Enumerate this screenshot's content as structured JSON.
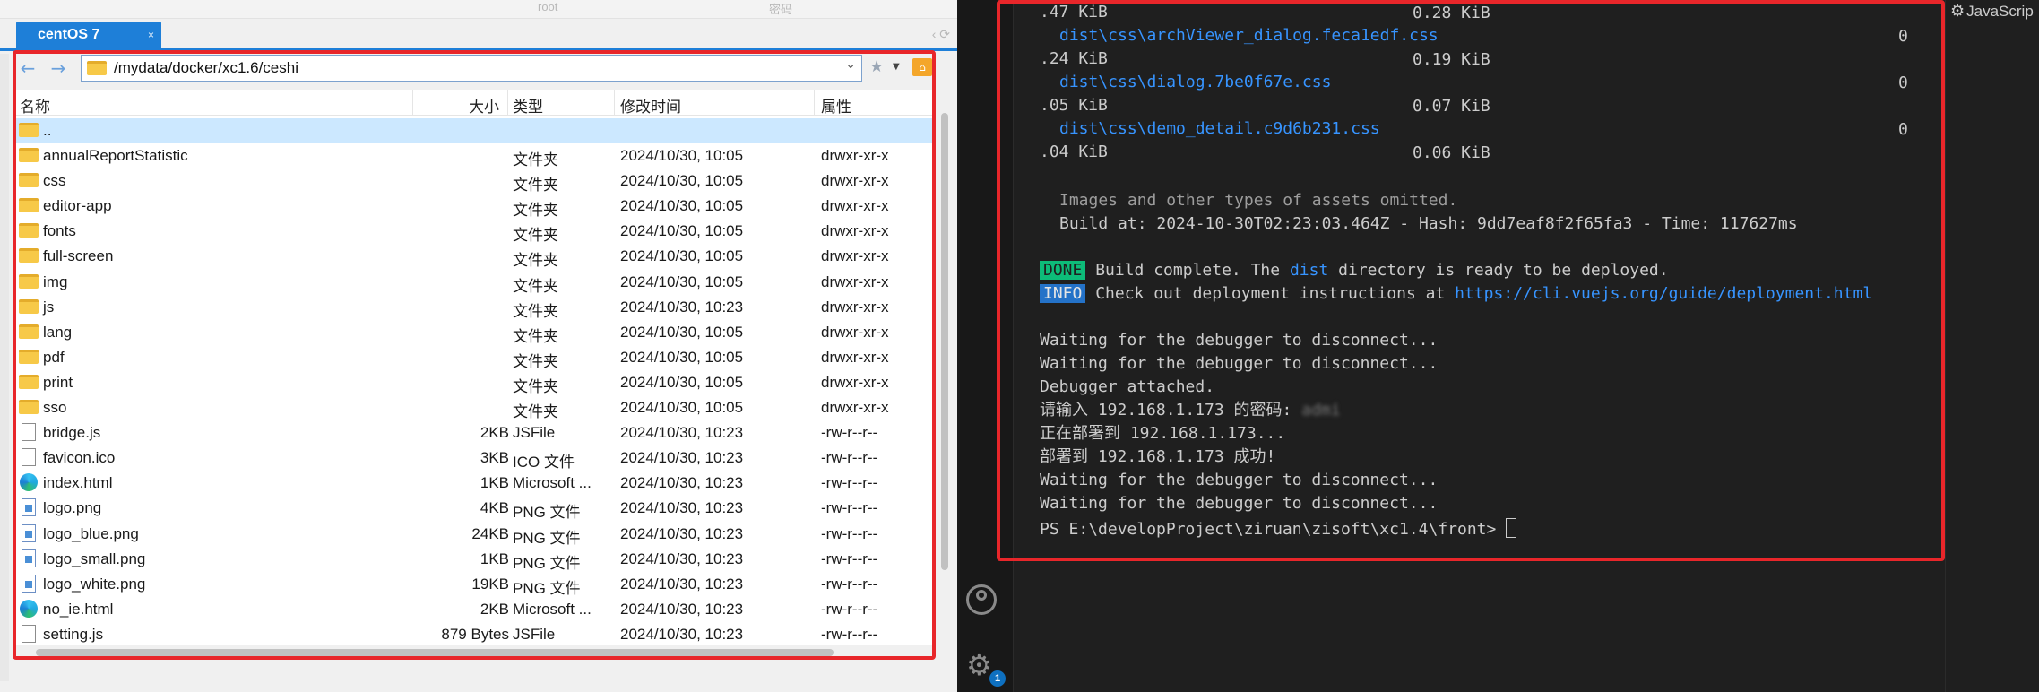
{
  "file_manager": {
    "ghost_labels": [
      "root",
      "密码"
    ],
    "tab": {
      "label": "centOS 7",
      "close": "×"
    },
    "path": "/mydata/docker/xc1.6/ceshi",
    "columns": [
      "名称",
      "大小",
      "类型",
      "修改时间",
      "属性"
    ],
    "rows": [
      {
        "name": "..",
        "size": "",
        "type": "",
        "mtime": "",
        "attr": "",
        "icon": "folder-icon"
      },
      {
        "name": "annualReportStatistic",
        "size": "",
        "type": "文件夹",
        "mtime": "2024/10/30, 10:05",
        "attr": "drwxr-xr-x",
        "icon": "folder-icon"
      },
      {
        "name": "css",
        "size": "",
        "type": "文件夹",
        "mtime": "2024/10/30, 10:05",
        "attr": "drwxr-xr-x",
        "icon": "folder-icon"
      },
      {
        "name": "editor-app",
        "size": "",
        "type": "文件夹",
        "mtime": "2024/10/30, 10:05",
        "attr": "drwxr-xr-x",
        "icon": "folder-icon"
      },
      {
        "name": "fonts",
        "size": "",
        "type": "文件夹",
        "mtime": "2024/10/30, 10:05",
        "attr": "drwxr-xr-x",
        "icon": "folder-icon"
      },
      {
        "name": "full-screen",
        "size": "",
        "type": "文件夹",
        "mtime": "2024/10/30, 10:05",
        "attr": "drwxr-xr-x",
        "icon": "folder-icon"
      },
      {
        "name": "img",
        "size": "",
        "type": "文件夹",
        "mtime": "2024/10/30, 10:05",
        "attr": "drwxr-xr-x",
        "icon": "folder-icon"
      },
      {
        "name": "js",
        "size": "",
        "type": "文件夹",
        "mtime": "2024/10/30, 10:23",
        "attr": "drwxr-xr-x",
        "icon": "folder-icon"
      },
      {
        "name": "lang",
        "size": "",
        "type": "文件夹",
        "mtime": "2024/10/30, 10:05",
        "attr": "drwxr-xr-x",
        "icon": "folder-icon"
      },
      {
        "name": "pdf",
        "size": "",
        "type": "文件夹",
        "mtime": "2024/10/30, 10:05",
        "attr": "drwxr-xr-x",
        "icon": "folder-icon"
      },
      {
        "name": "print",
        "size": "",
        "type": "文件夹",
        "mtime": "2024/10/30, 10:05",
        "attr": "drwxr-xr-x",
        "icon": "folder-icon"
      },
      {
        "name": "sso",
        "size": "",
        "type": "文件夹",
        "mtime": "2024/10/30, 10:05",
        "attr": "drwxr-xr-x",
        "icon": "folder-icon"
      },
      {
        "name": "bridge.js",
        "size": "2KB",
        "type": "JSFile",
        "mtime": "2024/10/30, 10:23",
        "attr": "-rw-r--r--",
        "icon": "file-icon"
      },
      {
        "name": "favicon.ico",
        "size": "3KB",
        "type": "ICO 文件",
        "mtime": "2024/10/30, 10:23",
        "attr": "-rw-r--r--",
        "icon": "file-icon"
      },
      {
        "name": "index.html",
        "size": "1KB",
        "type": "Microsoft ...",
        "mtime": "2024/10/30, 10:23",
        "attr": "-rw-r--r--",
        "icon": "edge-icon"
      },
      {
        "name": "logo.png",
        "size": "4KB",
        "type": "PNG 文件",
        "mtime": "2024/10/30, 10:23",
        "attr": "-rw-r--r--",
        "icon": "image-icon"
      },
      {
        "name": "logo_blue.png",
        "size": "24KB",
        "type": "PNG 文件",
        "mtime": "2024/10/30, 10:23",
        "attr": "-rw-r--r--",
        "icon": "image-icon"
      },
      {
        "name": "logo_small.png",
        "size": "1KB",
        "type": "PNG 文件",
        "mtime": "2024/10/30, 10:23",
        "attr": "-rw-r--r--",
        "icon": "image-icon"
      },
      {
        "name": "logo_white.png",
        "size": "19KB",
        "type": "PNG 文件",
        "mtime": "2024/10/30, 10:23",
        "attr": "-rw-r--r--",
        "icon": "image-icon"
      },
      {
        "name": "no_ie.html",
        "size": "2KB",
        "type": "Microsoft ...",
        "mtime": "2024/10/30, 10:23",
        "attr": "-rw-r--r--",
        "icon": "edge-icon"
      },
      {
        "name": "setting.js",
        "size": "879 Bytes",
        "type": "JSFile",
        "mtime": "2024/10/30, 10:23",
        "attr": "-rw-r--r--",
        "icon": "file-icon"
      }
    ],
    "selected_row": 0
  },
  "terminal": {
    "size_rows": [
      {
        "a": ".47 KiB",
        "b": "0.28 KiB"
      },
      {
        "file": "dist\\css\\archViewer_dialog.feca1edf.css",
        "z": "0"
      },
      {
        "a": ".24 KiB",
        "b": "0.19 KiB"
      },
      {
        "file": "dist\\css\\dialog.7be0f67e.css",
        "z": "0"
      },
      {
        "a": ".05 KiB",
        "b": "0.07 KiB"
      },
      {
        "file": "dist\\css\\demo_detail.c9d6b231.css",
        "z": "0"
      },
      {
        "a": ".04 KiB",
        "b": "0.06 KiB"
      }
    ],
    "omitted": "Images and other types of assets omitted.",
    "build_line": "Build at: 2024-10-30T02:23:03.464Z - Hash: 9dd7eaf8f2f65fa3 - Time: 117627ms",
    "done_badge": "DONE",
    "done_pre": "Build complete. The ",
    "done_word": "dist",
    "done_post": " directory is ready to be deployed.",
    "info_badge": "INFO",
    "info_pre": "Check out deployment instructions at ",
    "info_link": "https://cli.vuejs.org/guide/deployment.html",
    "lines_after": [
      "Waiting for the debugger to disconnect...",
      "Waiting for the debugger to disconnect...",
      "Debugger attached.",
      "请输入 192.168.1.173 的密码: ",
      "正在部署到 192.168.1.173...",
      "部署到 192.168.1.173 成功!",
      "Waiting for the debugger to disconnect...",
      "Waiting for the debugger to disconnect..."
    ],
    "password_masked": "admi",
    "prompt": "PS E:\\developProject\\ziruan\\zisoft\\xc1.4\\front> ",
    "settings_badge": "1",
    "js_button": "JavaScrip"
  },
  "colors": {
    "accent": "#1e7fd8",
    "highlight": "#e8262a",
    "link": "#3794ff",
    "done": "#0dbc79",
    "info": "#2472c8"
  }
}
